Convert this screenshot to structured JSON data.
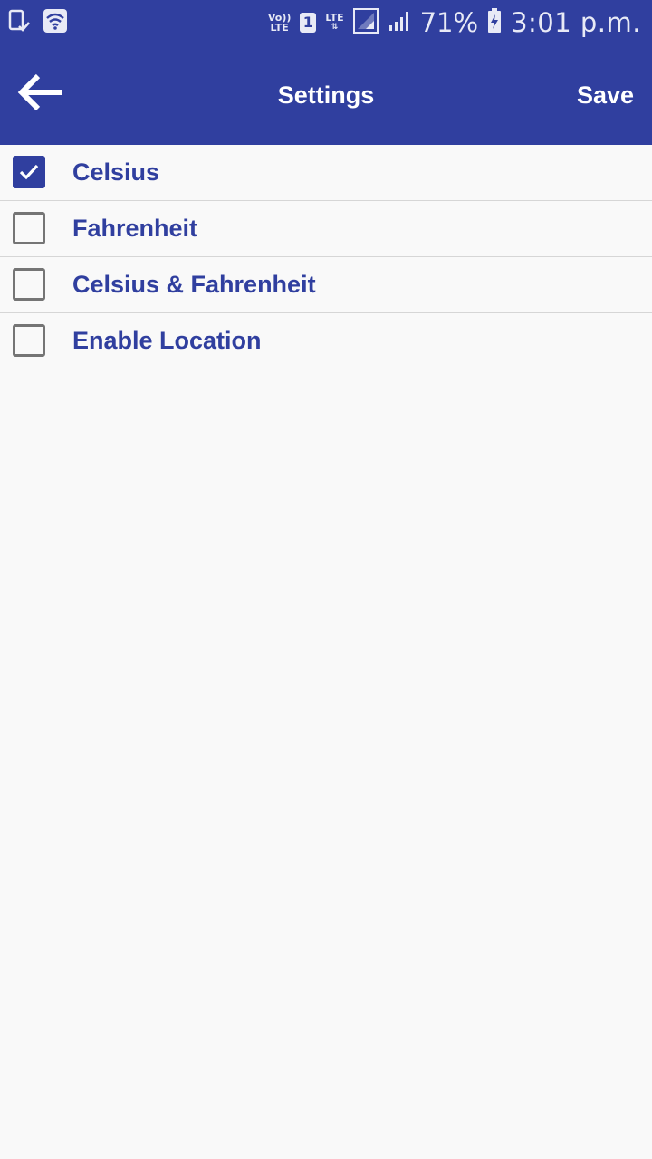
{
  "status_bar": {
    "volte_line1": "Vo))",
    "volte_line2": "LTE",
    "sim_number": "1",
    "lte_label": "LTE",
    "battery_percent": "71%",
    "time": "3:01 p.m.",
    "icons": [
      "notification-icon",
      "wifi-icon",
      "volte-icon",
      "sim-icon",
      "signal-icon",
      "battery-charging-icon"
    ]
  },
  "app_bar": {
    "title": "Settings",
    "save_label": "Save",
    "back_icon": "arrow-left-icon",
    "background_color": "#303f9f"
  },
  "options": [
    {
      "label": "Celsius",
      "checked": true
    },
    {
      "label": "Fahrenheit",
      "checked": false
    },
    {
      "label": "Celsius & Fahrenheit",
      "checked": false
    },
    {
      "label": "Enable Location",
      "checked": false
    }
  ],
  "colors": {
    "accent": "#303f9f",
    "background": "#f9f9f9",
    "divider": "#d6d6d6",
    "unchecked_box": "#757575"
  }
}
